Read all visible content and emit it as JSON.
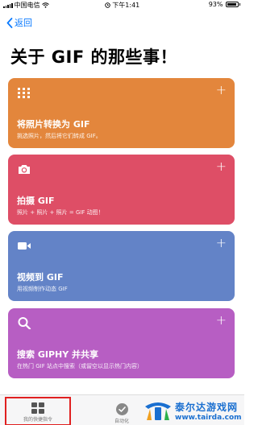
{
  "status_bar": {
    "carrier": "中国电信",
    "time": "下午1:41",
    "battery": "93%"
  },
  "nav": {
    "back_label": "返回"
  },
  "page": {
    "title": "关于 GIF 的那些事！"
  },
  "cards": [
    {
      "title": "将照片转换为 GIF",
      "description": "挑选照片，然后将它们转成 GIF。",
      "color": "#e3863c",
      "icon": "grid-icon"
    },
    {
      "title": "拍摄 GIF",
      "description": "照片 + 照片 + 照片 = GIF 动图！",
      "color": "#de4e66",
      "icon": "camera-icon"
    },
    {
      "title": "视频到 GIF",
      "description": "用视频制作动态 GIF",
      "color": "#6383c7",
      "icon": "video-camera-icon"
    },
    {
      "title": "搜索 GIPHY 并共享",
      "description": "在热门 GIF 站点中搜索（或留空以显示热门内容）",
      "color": "#b75ec3",
      "icon": "search-icon"
    }
  ],
  "tab_bar": {
    "shortcuts_label": "我的快捷指令",
    "automation_label": "自动化"
  },
  "watermark": {
    "name": "泰尔达游戏网",
    "url": "www.tairda.com"
  }
}
